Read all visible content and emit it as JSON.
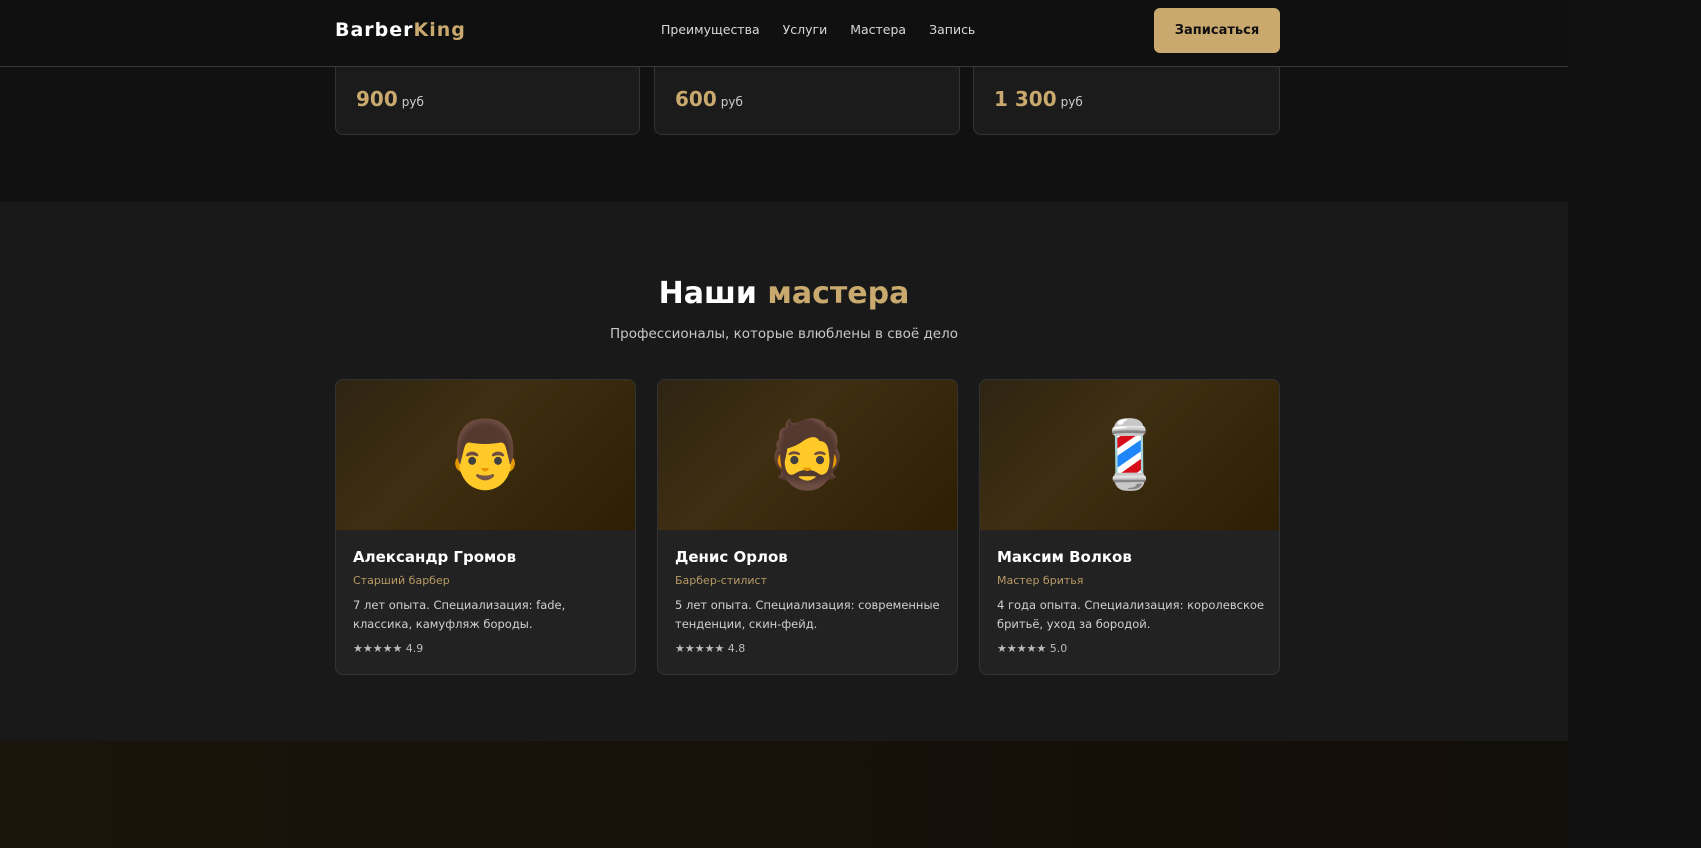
{
  "header": {
    "logo_a": "Barber",
    "logo_b": "King",
    "nav": [
      "Преимущества",
      "Услуги",
      "Мастера",
      "Запись"
    ],
    "cta": "Записаться"
  },
  "prices": [
    {
      "amount": "900",
      "currency": "руб"
    },
    {
      "amount": "600",
      "currency": "руб"
    },
    {
      "amount": "1 300",
      "currency": "руб"
    }
  ],
  "masters": {
    "title_a": "Наши",
    "title_b": "мастера",
    "subtitle": "Профессионалы, которые влюблены в своё дело",
    "cards": [
      {
        "emoji": "👨",
        "name": "Александр Громов",
        "role": "Старший барбер",
        "desc": "7 лет опыта. Специализация: fade, классика, камуфляж бороды.",
        "rating": "★★★★★ 4.9"
      },
      {
        "emoji": "🧔",
        "name": "Денис Орлов",
        "role": "Барбер-стилист",
        "desc": "5 лет опыта. Специализация: современные тенденции, скин-фейд.",
        "rating": "★★★★★ 4.8"
      },
      {
        "emoji": "💈",
        "name": "Максим Волков",
        "role": "Мастер бритья",
        "desc": "4 года опыта. Специализация: королевское бритьё, уход за бородой.",
        "rating": "★★★★★ 5.0"
      }
    ]
  }
}
